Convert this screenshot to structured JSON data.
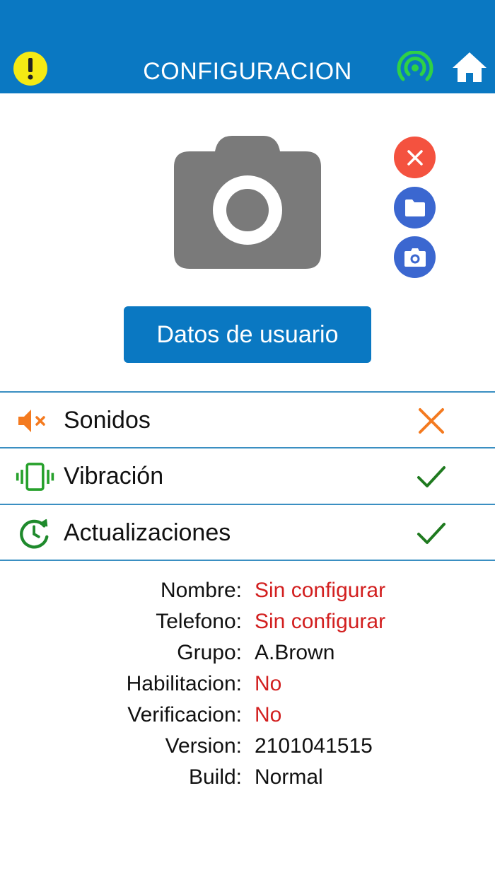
{
  "header": {
    "title": "CONFIGURACION",
    "alert_icon": "alert-icon",
    "signal_icon": "signal-icon",
    "home_icon": "home-icon",
    "colors": {
      "bar": "#0a78c2",
      "alert": "#f5ea14",
      "signal": "#2fd146"
    }
  },
  "photo": {
    "placeholder_icon": "camera-icon",
    "actions": [
      {
        "icon": "close-icon",
        "color": "#f4523f"
      },
      {
        "icon": "folder-icon",
        "color": "#3b67d0"
      },
      {
        "icon": "camera-icon",
        "color": "#3b67d0"
      }
    ]
  },
  "user_data_button": "Datos de usuario",
  "settings": [
    {
      "label": "Sonidos",
      "icon": "speaker-muted-icon",
      "enabled": false
    },
    {
      "label": "Vibración",
      "icon": "vibration-icon",
      "enabled": true
    },
    {
      "label": "Actualizaciones",
      "icon": "update-clock-icon",
      "enabled": true
    }
  ],
  "info": {
    "rows": [
      {
        "label": "Nombre:",
        "value": "Sin configurar"
      },
      {
        "label": "Telefono:",
        "value": "Sin configurar"
      },
      {
        "label": "Grupo:",
        "value": "A.Brown"
      },
      {
        "label": "Habilitacion:",
        "value": "No"
      },
      {
        "label": "Verificacion:",
        "value": "No"
      },
      {
        "label": "Version:",
        "value": "2101041515"
      },
      {
        "label": "Build:",
        "value": "Normal"
      }
    ],
    "status_color": "#d21f1f"
  }
}
